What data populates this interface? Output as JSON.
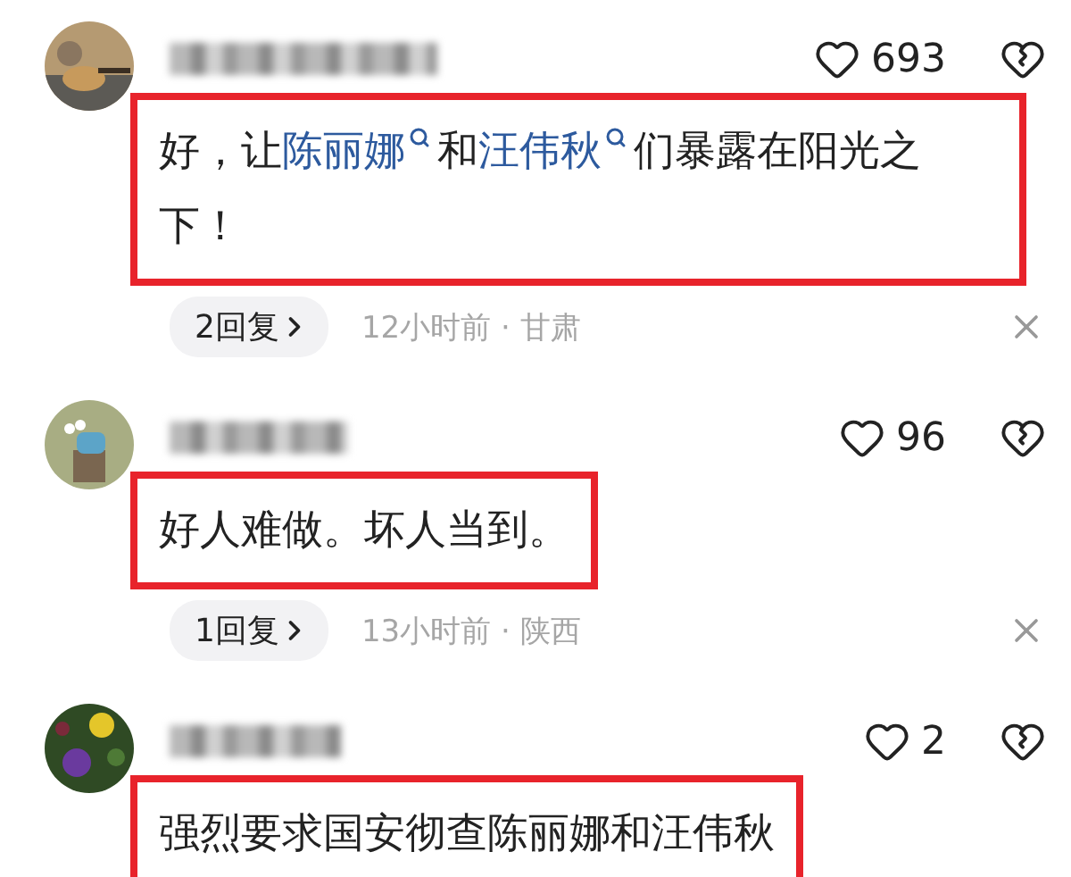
{
  "comments": [
    {
      "likes": "693",
      "highlighted": true,
      "content": [
        {
          "kind": "plain",
          "text": "好，让"
        },
        {
          "kind": "link",
          "text": "陈丽娜"
        },
        {
          "kind": "plain",
          "text": "和"
        },
        {
          "kind": "link",
          "text": "汪伟秋"
        },
        {
          "kind": "plain",
          "text": "们暴露在阳光之下！"
        }
      ],
      "replies": "2回复",
      "time": "12小时前 · 甘肃"
    },
    {
      "likes": "96",
      "highlighted": true,
      "content": [
        {
          "kind": "plain",
          "text": "好人难做。坏人当到。"
        }
      ],
      "replies": "1回复",
      "time": "13小时前 · 陕西"
    },
    {
      "likes": "2",
      "highlighted": true,
      "content": [
        {
          "kind": "plain",
          "text": "强烈要求国安彻查陈丽娜和汪伟秋"
        }
      ]
    }
  ]
}
